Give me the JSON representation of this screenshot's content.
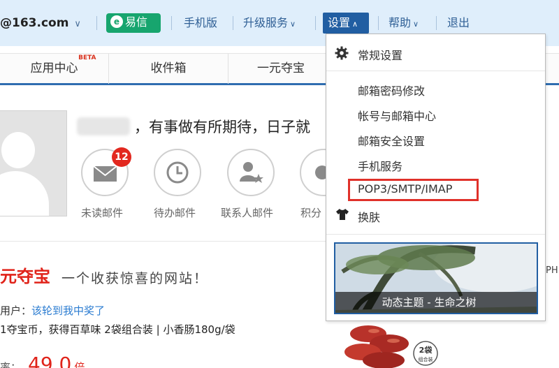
{
  "topbar": {
    "email": "@163.com",
    "yixin_label": "易信",
    "mobile_label": "手机版",
    "upgrade_label": "升级服务",
    "settings_label": "设置",
    "help_label": "帮助",
    "logout_label": "退出"
  },
  "nav": {
    "app_center": "应用中心",
    "beta": "BETA",
    "inbox": "收件箱",
    "yiyuan": "一元夺宝"
  },
  "profile": {
    "greeting": "，有事做有所期待，日子就",
    "unread_count": "12",
    "shortcuts": [
      "未读邮件",
      "待办邮件",
      "联系人邮件",
      "积分"
    ]
  },
  "promo": {
    "title": "元夺宝",
    "slogan": "一个收获惊喜的网站！",
    "user_prefix": "用户：",
    "user_winner": "该轮到我中奖了",
    "prize": "1夺宝币，获得百草味 2袋组合装 | 小香肠180g/袋",
    "rate_prefix": "率：",
    "rate_value": "49.0",
    "rate_unit": "倍",
    "pack_badge": "2袋",
    "pack_sub": "组合装"
  },
  "right_fragment": "PH",
  "dropdown": {
    "general": "常规设置",
    "items": [
      "邮箱密码修改",
      "帐号与邮箱中心",
      "邮箱安全设置",
      "手机服务",
      "POP3/SMTP/IMAP"
    ],
    "skin": "换肤",
    "theme_caption": "动态主题 - 生命之树"
  },
  "colors": {
    "topbar_bg": "#dfeefb",
    "accent_blue": "#215ea2",
    "yixin_green": "#17a56e",
    "highlight_red": "#e0312a",
    "badge_red": "#e2281f"
  }
}
